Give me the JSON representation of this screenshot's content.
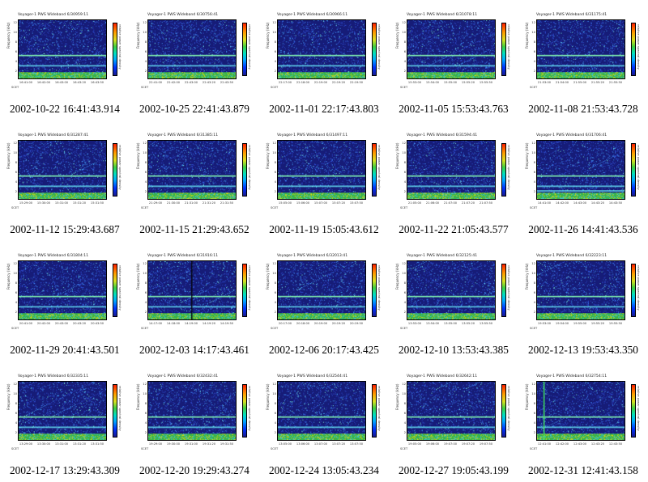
{
  "page": {
    "panel_title_prefix": "Voyager-1  PWS Wideband",
    "ylabel": "Frequency (kHz)",
    "yticks": [
      "12",
      "10",
      "8",
      "6",
      "4",
      "2"
    ],
    "colorbar_label": "relative power spectral density",
    "colorbar_ticks": [
      "10⁻¹",
      "10⁻²",
      "10⁻³",
      "10⁻⁴",
      "10⁻⁵",
      "10⁻⁶"
    ],
    "footer_scet": "SCET"
  },
  "chart_data": [
    {
      "type": "heatmap",
      "title": "Voyager-1  PWS Wideband  6/30959:11",
      "caption": "2002-10-22 16:41:43.914",
      "xticks": [
        "16:41:00",
        "16:42:00",
        "16:43:00",
        "16:43:20",
        "16:43:50"
      ],
      "ylim": [
        0,
        12
      ],
      "colorscale": "jet",
      "bands_khz": [
        4.8,
        2.7
      ]
    },
    {
      "type": "heatmap",
      "title": "Voyager-1  PWS Wideband  6/30756:41",
      "caption": "2002-10-25 22:41:43.879",
      "xticks": [
        "22:41:00",
        "22:42:00",
        "22:43:00",
        "22:43:20",
        "22:43:50"
      ],
      "ylim": [
        0,
        12
      ],
      "colorscale": "jet",
      "bands_khz": [
        4.8,
        2.7
      ]
    },
    {
      "type": "heatmap",
      "title": "Voyager-1  PWS Wideband  6/30966:11",
      "caption": "2002-11-01 22:17:43.803",
      "xticks": [
        "22:17:00",
        "22:18:00",
        "22:19:00",
        "22:19:20",
        "22:19:50"
      ],
      "ylim": [
        0,
        12
      ],
      "colorscale": "jet",
      "bands_khz": [
        4.8,
        2.7
      ]
    },
    {
      "type": "heatmap",
      "title": "Voyager-1  PWS Wideband  6/31078:11",
      "caption": "2002-11-05 15:53:43.763",
      "xticks": [
        "15:53:00",
        "15:54:00",
        "15:55:00",
        "15:55:20",
        "15:55:50"
      ],
      "ylim": [
        0,
        12
      ],
      "colorscale": "jet",
      "bands_khz": [
        4.8,
        2.7
      ]
    },
    {
      "type": "heatmap",
      "title": "Voyager-1  PWS Wideband  6/31175:41",
      "caption": "2002-11-08 21:53:43.728",
      "xticks": [
        "21:53:00",
        "21:54:00",
        "21:55:00",
        "21:55:20",
        "21:55:50"
      ],
      "ylim": [
        0,
        12
      ],
      "colorscale": "jet",
      "bands_khz": [
        4.8,
        2.7
      ]
    },
    {
      "type": "heatmap",
      "title": "Voyager-1  PWS Wideband  6/31287:41",
      "caption": "2002-11-12 15:29:43.687",
      "xticks": [
        "15:29:00",
        "15:30:00",
        "15:31:00",
        "15:31:20",
        "15:31:50"
      ],
      "ylim": [
        0,
        12
      ],
      "colorscale": "jet",
      "bands_khz": [
        4.8,
        2.7
      ]
    },
    {
      "type": "heatmap",
      "title": "Voyager-1  PWS Wideband  6/31385:11",
      "caption": "2002-11-15 21:29:43.652",
      "xticks": [
        "21:29:00",
        "21:30:00",
        "21:31:00",
        "21:31:20",
        "21:31:50"
      ],
      "ylim": [
        0,
        12
      ],
      "colorscale": "jet",
      "bands_khz": [
        4.8,
        2.7
      ]
    },
    {
      "type": "heatmap",
      "title": "Voyager-1  PWS Wideband  6/31497:11",
      "caption": "2002-11-19 15:05:43.612",
      "xticks": [
        "15:05:00",
        "15:06:00",
        "15:07:00",
        "15:07:20",
        "15:07:50"
      ],
      "ylim": [
        0,
        12
      ],
      "colorscale": "jet",
      "bands_khz": [
        4.8,
        2.7
      ]
    },
    {
      "type": "heatmap",
      "title": "Voyager-1  PWS Wideband  6/31594:41",
      "caption": "2002-11-22 21:05:43.577",
      "xticks": [
        "21:05:00",
        "21:06:00",
        "21:07:00",
        "21:07:20",
        "21:07:50"
      ],
      "ylim": [
        0,
        12
      ],
      "colorscale": "jet",
      "bands_khz": [
        4.8,
        2.7
      ]
    },
    {
      "type": "heatmap",
      "title": "Voyager-1  PWS Wideband  6/31706:41",
      "caption": "2002-11-26 14:41:43.536",
      "xticks": [
        "14:41:00",
        "14:42:00",
        "14:43:00",
        "14:43:20",
        "14:43:50"
      ],
      "ylim": [
        0,
        12
      ],
      "colorscale": "jet",
      "bands_khz": [
        4.8,
        2.7,
        1.8
      ]
    },
    {
      "type": "heatmap",
      "title": "Voyager-1  PWS Wideband  6/31804:11",
      "caption": "2002-11-29 20:41:43.501",
      "xticks": [
        "20:41:00",
        "20:42:00",
        "20:43:00",
        "20:43:20",
        "20:43:50"
      ],
      "ylim": [
        0,
        12
      ],
      "colorscale": "jet",
      "bands_khz": [
        4.8,
        2.7
      ]
    },
    {
      "type": "heatmap",
      "title": "Voyager-1  PWS Wideband  6/31916:11",
      "caption": "2002-12-03 14:17:43.461",
      "xticks": [
        "14:17:00",
        "14:18:00",
        "14:19:00",
        "14:19:20",
        "14:19:50"
      ],
      "ylim": [
        0,
        12
      ],
      "colorscale": "jet",
      "bands_khz": [
        4.8,
        2.7
      ]
    },
    {
      "type": "heatmap",
      "title": "Voyager-1  PWS Wideband  6/32013:41",
      "caption": "2002-12-06 20:17:43.425",
      "xticks": [
        "20:17:00",
        "20:18:00",
        "20:19:00",
        "20:19:20",
        "20:19:50"
      ],
      "ylim": [
        0,
        12
      ],
      "colorscale": "jet",
      "bands_khz": [
        4.8,
        2.7
      ]
    },
    {
      "type": "heatmap",
      "title": "Voyager-1  PWS Wideband  6/32125:41",
      "caption": "2002-12-10 13:53:43.385",
      "xticks": [
        "13:53:00",
        "13:54:00",
        "13:55:00",
        "13:55:20",
        "13:55:50"
      ],
      "ylim": [
        0,
        12
      ],
      "colorscale": "jet",
      "bands_khz": [
        4.8,
        2.7
      ]
    },
    {
      "type": "heatmap",
      "title": "Voyager-1  PWS Wideband  6/32223:11",
      "caption": "2002-12-13 19:53:43.350",
      "xticks": [
        "19:53:00",
        "19:54:00",
        "19:55:00",
        "19:55:20",
        "19:55:50"
      ],
      "ylim": [
        0,
        12
      ],
      "colorscale": "jet",
      "bands_khz": [
        4.8,
        2.7
      ]
    },
    {
      "type": "heatmap",
      "title": "Voyager-1  PWS Wideband  6/32335:11",
      "caption": "2002-12-17 13:29:43.309",
      "xticks": [
        "13:29:00",
        "13:30:00",
        "13:31:00",
        "13:31:20",
        "13:31:50"
      ],
      "ylim": [
        0,
        12
      ],
      "colorscale": "jet",
      "bands_khz": [
        4.8,
        2.7
      ]
    },
    {
      "type": "heatmap",
      "title": "Voyager-1  PWS Wideband  6/32432:41",
      "caption": "2002-12-20 19:29:43.274",
      "xticks": [
        "19:29:00",
        "19:30:00",
        "19:31:00",
        "19:31:20",
        "19:31:50"
      ],
      "ylim": [
        0,
        12
      ],
      "colorscale": "jet",
      "bands_khz": [
        4.8,
        2.7
      ]
    },
    {
      "type": "heatmap",
      "title": "Voyager-1  PWS Wideband  6/32544:41",
      "caption": "2002-12-24 13:05:43.234",
      "xticks": [
        "13:05:00",
        "13:06:00",
        "13:07:00",
        "13:07:20",
        "13:07:50"
      ],
      "ylim": [
        0,
        12
      ],
      "colorscale": "jet",
      "bands_khz": [
        4.8,
        2.7
      ]
    },
    {
      "type": "heatmap",
      "title": "Voyager-1  PWS Wideband  6/32642:11",
      "caption": "2002-12-27 19:05:43.199",
      "xticks": [
        "19:05:00",
        "19:06:00",
        "19:07:00",
        "19:07:20",
        "19:07:50"
      ],
      "ylim": [
        0,
        12
      ],
      "colorscale": "jet",
      "bands_khz": [
        4.8,
        2.7
      ]
    },
    {
      "type": "heatmap",
      "title": "Voyager-1  PWS Wideband  6/32754:11",
      "caption": "2002-12-31 12:41:43.158",
      "xticks": [
        "12:41:00",
        "12:42:00",
        "12:43:00",
        "12:43:20",
        "12:43:50"
      ],
      "ylim": [
        0,
        12
      ],
      "colorscale": "jet",
      "bands_khz": [
        4.8,
        2.7
      ]
    }
  ]
}
